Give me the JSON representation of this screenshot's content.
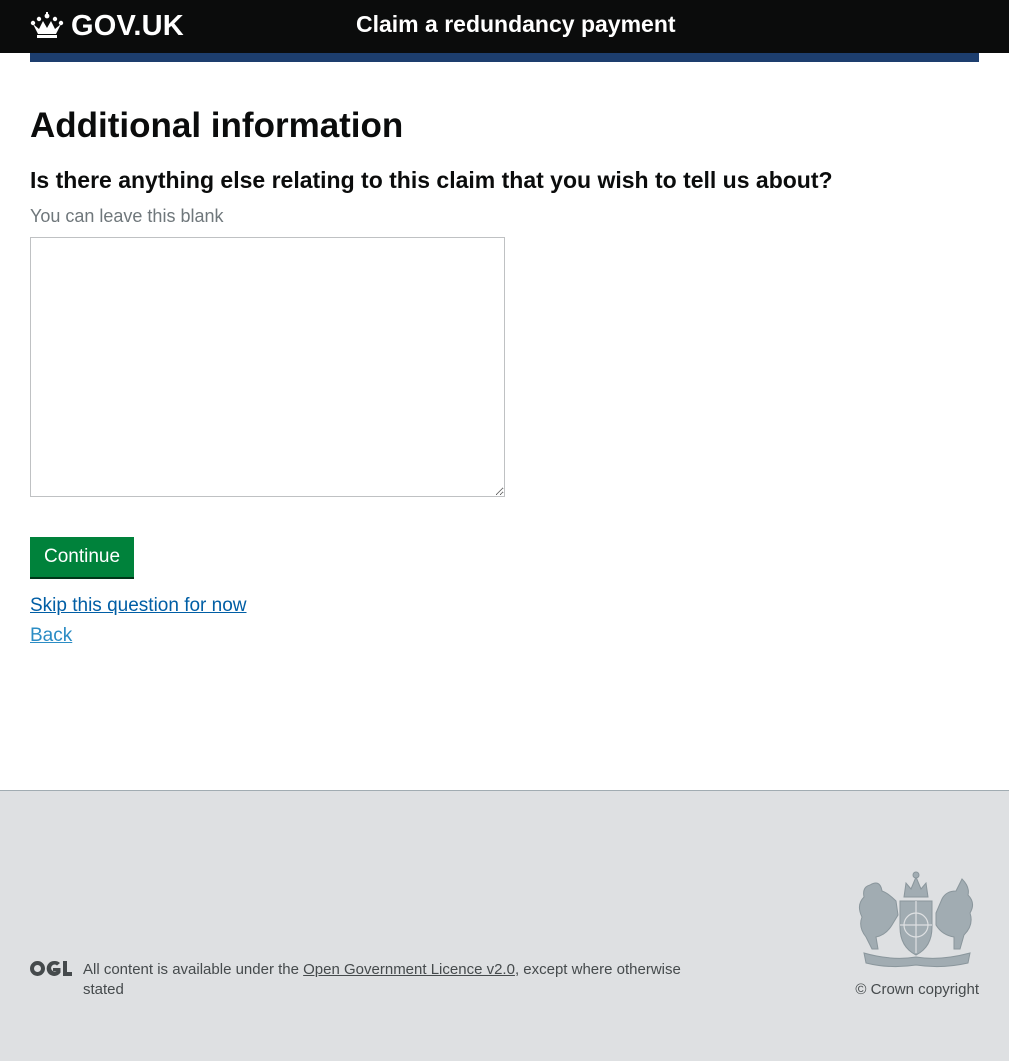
{
  "header": {
    "logo_text": "GOV.UK",
    "service_name": "Claim a redundancy payment",
    "background": "#0b0c0c",
    "bar_color": "#1d3e6e"
  },
  "main": {
    "title": "Additional information",
    "question": "Is there anything else relating to this claim that you wish to tell us about?",
    "hint": "You can leave this blank",
    "textarea_value": "",
    "continue_label": "Continue",
    "skip_label": "Skip this question for now",
    "back_label": "Back",
    "button_color": "#00823b",
    "link_color": "#005ea5"
  },
  "footer": {
    "ogl_label": "OGL",
    "licence_prefix": "All content is available under the ",
    "licence_link": "Open Government Licence v2.0",
    "licence_suffix": ", except where otherwise stated",
    "copyright": "© Crown copyright",
    "background": "#dee0e2"
  },
  "icons": {
    "logo": "crown-icon",
    "ogl": "ogl-logo-icon",
    "crest": "royal-coat-of-arms-icon"
  }
}
